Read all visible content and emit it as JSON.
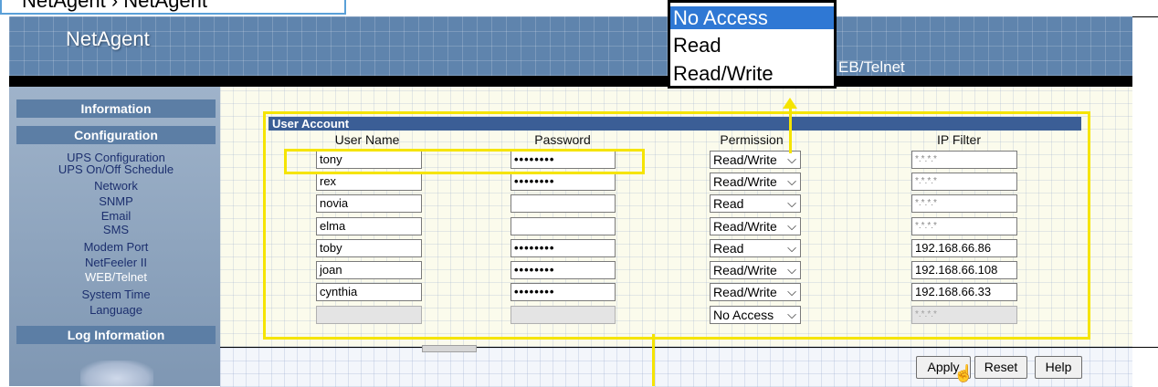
{
  "caption": "NetAgent  ›  NetAgent",
  "header": {
    "logo": "NetAgent",
    "page_title": "EB/Telnet"
  },
  "sidebar": {
    "sections": [
      "Information",
      "Configuration",
      "Log Information"
    ],
    "links": [
      "UPS Configuration",
      "UPS On/Off Schedule",
      "Network",
      "SNMP",
      "Email",
      "SMS",
      "Modem Port",
      "NetFeeler II",
      "WEB/Telnet",
      "System Time",
      "Language"
    ],
    "active": "WEB/Telnet"
  },
  "panel": {
    "title": "User Account",
    "columns": [
      "User Name",
      "Password",
      "Permission",
      "IP Filter"
    ],
    "rows": [
      {
        "user": "tony",
        "password": "••••••••",
        "permission": "Read/Write",
        "ip": "*.*.*.*"
      },
      {
        "user": "rex",
        "password": "••••••••",
        "permission": "Read/Write",
        "ip": "*.*.*.*"
      },
      {
        "user": "novia",
        "password": "",
        "permission": "Read",
        "ip": "*.*.*.*"
      },
      {
        "user": "elma",
        "password": "",
        "permission": "Read/Write",
        "ip": "*.*.*.*"
      },
      {
        "user": "toby",
        "password": "••••••••",
        "permission": "Read",
        "ip": "192.168.66.86"
      },
      {
        "user": "joan",
        "password": "••••••••",
        "permission": "Read/Write",
        "ip": "192.168.66.108"
      },
      {
        "user": "cynthia",
        "password": "••••••••",
        "permission": "Read/Write",
        "ip": "192.168.66.33"
      },
      {
        "user": "",
        "password": "",
        "permission": "No Access",
        "ip": "*.*.*.*"
      }
    ]
  },
  "dropdown": {
    "options": [
      "No Access",
      "Read",
      "Read/Write"
    ],
    "selected": "No Access"
  },
  "buttons": {
    "apply": "Apply",
    "reset": "Reset",
    "help": "Help"
  },
  "icons": {
    "chevron": "chevron-down-icon",
    "cursor": "hand-cursor-icon"
  },
  "colors": {
    "highlight": "#f5e400",
    "header": "#5f84ad",
    "panel_title": "#3b5e96",
    "selected_option": "#2f78d4"
  }
}
